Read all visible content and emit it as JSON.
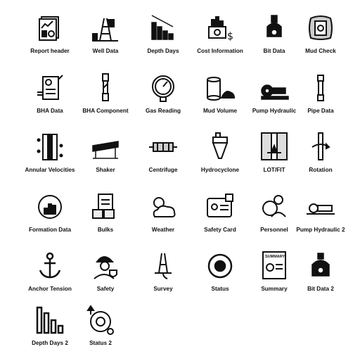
{
  "icons": [
    {
      "label": "Report header",
      "icon": "report-header-icon"
    },
    {
      "label": "Well Data",
      "icon": "well-data-icon"
    },
    {
      "label": "Depth Days",
      "icon": "depth-days-icon"
    },
    {
      "label": "Cost Information",
      "icon": "cost-information-icon"
    },
    {
      "label": "Bit Data",
      "icon": "bit-data-icon"
    },
    {
      "label": "Mud Check",
      "icon": "mud-check-icon"
    },
    {
      "label": "BHA Data",
      "icon": "bha-data-icon"
    },
    {
      "label": "BHA Component",
      "icon": "bha-component-icon"
    },
    {
      "label": "Gas Reading",
      "icon": "gas-reading-icon"
    },
    {
      "label": "Mud Volume",
      "icon": "mud-volume-icon"
    },
    {
      "label": "Pump Hydraulic",
      "icon": "pump-hydraulic-icon"
    },
    {
      "label": "Pipe Data",
      "icon": "pipe-data-icon"
    },
    {
      "label": "Annular Velocities",
      "icon": "annular-velocities-icon"
    },
    {
      "label": "Shaker",
      "icon": "shaker-icon"
    },
    {
      "label": "Centrifuge",
      "icon": "centrifuge-icon"
    },
    {
      "label": "Hydrocyclone",
      "icon": "hydrocyclone-icon"
    },
    {
      "label": "LOT/FIT",
      "icon": "lot-fit-icon"
    },
    {
      "label": "Rotation",
      "icon": "rotation-icon"
    },
    {
      "label": "Formation Data",
      "icon": "formation-data-icon"
    },
    {
      "label": "Bulks",
      "icon": "bulks-icon"
    },
    {
      "label": "Weather",
      "icon": "weather-icon"
    },
    {
      "label": "Safety Card",
      "icon": "safety-card-icon"
    },
    {
      "label": "Personnel",
      "icon": "personnel-icon"
    },
    {
      "label": "Pump Hydraulic 2",
      "icon": "pump-hydraulic-2-icon"
    },
    {
      "label": "Anchor Tension",
      "icon": "anchor-tension-icon"
    },
    {
      "label": "Safety",
      "icon": "safety-icon"
    },
    {
      "label": "Survey",
      "icon": "survey-icon"
    },
    {
      "label": "Status",
      "icon": "status-icon"
    },
    {
      "label": "Summary",
      "icon": "summary-icon"
    },
    {
      "label": "Bit Data 2",
      "icon": "bit-data-2-icon"
    },
    {
      "label": "Depth Days 2",
      "icon": "depth-days-2-icon"
    },
    {
      "label": "Status 2",
      "icon": "status-2-icon"
    }
  ],
  "summary_badge": "SUMMARY"
}
